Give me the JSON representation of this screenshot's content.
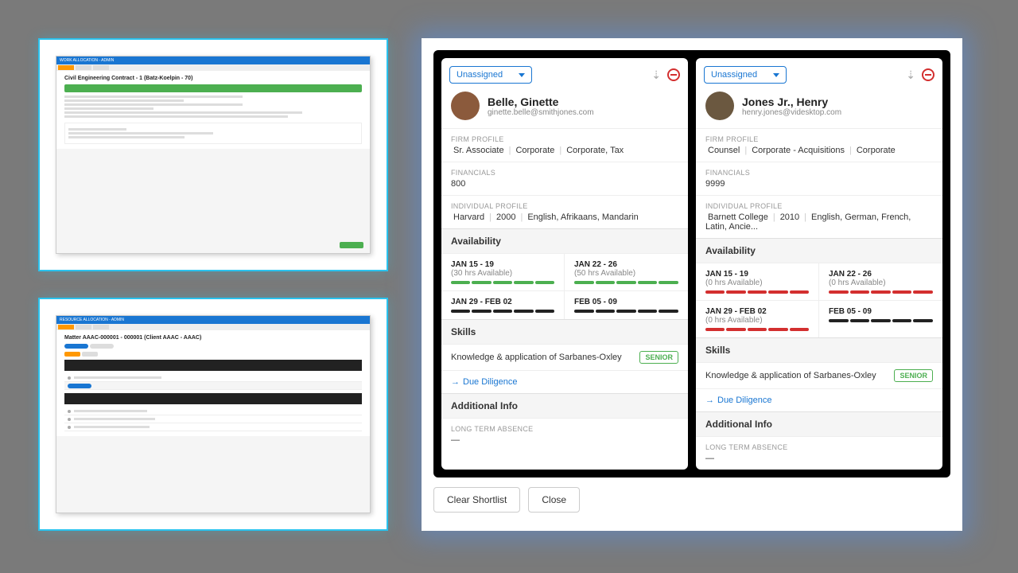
{
  "thumb1": {
    "header": "WORK ALLOCATION - ADMIN",
    "title": "Civil Engineering Contract - 1 (Batz-Koelpin - 70)"
  },
  "thumb2": {
    "header": "RESOURCE ALLOCATION - ADMIN",
    "title": "Matter AAAC-000001 - 000001 (Client AAAC - AAAC)"
  },
  "dropdown": "Unassigned",
  "cards": [
    {
      "name": "Belle, Ginette",
      "email": "ginette.belle@smithjones.com",
      "firm_label": "FIRM PROFILE",
      "firm": [
        "Sr. Associate",
        "Corporate",
        "Corporate, Tax"
      ],
      "fin_label": "FINANCIALS",
      "fin": "800",
      "ind_label": "INDIVIDUAL PROFILE",
      "ind": [
        "Harvard",
        "2000",
        "English, Afrikaans, Mandarin"
      ],
      "avail_label": "Availability",
      "avail": [
        {
          "d": "JAN 15 - 19",
          "h": "(30 hrs Available)",
          "c": "bg"
        },
        {
          "d": "JAN 22 - 26",
          "h": "(50 hrs Available)",
          "c": "bg"
        },
        {
          "d": "JAN 29 - FEB 02",
          "h": "",
          "c": "bk"
        },
        {
          "d": "FEB 05 - 09",
          "h": "",
          "c": "bk"
        }
      ],
      "skills_label": "Skills",
      "skill": "Knowledge & application of Sarbanes-Oxley",
      "badge": "SENIOR",
      "due": "Due Diligence",
      "addl_label": "Additional Info",
      "abs_label": "LONG TERM ABSENCE",
      "abs": "—"
    },
    {
      "name": "Jones Jr., Henry",
      "email": "henry.jones@videsktop.com",
      "firm_label": "FIRM PROFILE",
      "firm": [
        "Counsel",
        "Corporate - Acquisitions",
        "Corporate"
      ],
      "fin_label": "FINANCIALS",
      "fin": "9999",
      "ind_label": "INDIVIDUAL PROFILE",
      "ind": [
        "Barnett College",
        "2010",
        "English, German, French, Latin, Ancie..."
      ],
      "avail_label": "Availability",
      "avail": [
        {
          "d": "JAN 15 - 19",
          "h": "(0 hrs Available)",
          "c": "br"
        },
        {
          "d": "JAN 22 - 26",
          "h": "(0 hrs Available)",
          "c": "br"
        },
        {
          "d": "JAN 29 - FEB 02",
          "h": "(0 hrs Available)",
          "c": "br"
        },
        {
          "d": "FEB 05 - 09",
          "h": "",
          "c": "bk"
        }
      ],
      "skills_label": "Skills",
      "skill": "Knowledge & application of Sarbanes-Oxley",
      "badge": "SENIOR",
      "due": "Due Diligence",
      "addl_label": "Additional Info",
      "abs_label": "LONG TERM ABSENCE",
      "abs": "—"
    }
  ],
  "buttons": {
    "clear": "Clear Shortlist",
    "close": "Close"
  }
}
